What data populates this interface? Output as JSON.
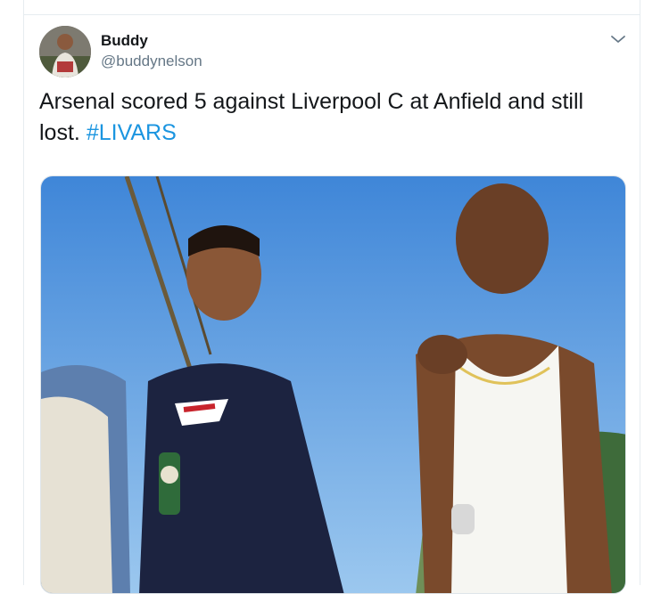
{
  "tweet": {
    "author_name": "Buddy",
    "author_handle": "@buddynelson",
    "text_main": "Arsenal scored 5 against Liverpool C at Anfield and still lost.",
    "hashtag": "#LIVARS",
    "link_color": "#1b95e0"
  },
  "icons": {
    "menu": "chevron-down-icon"
  }
}
